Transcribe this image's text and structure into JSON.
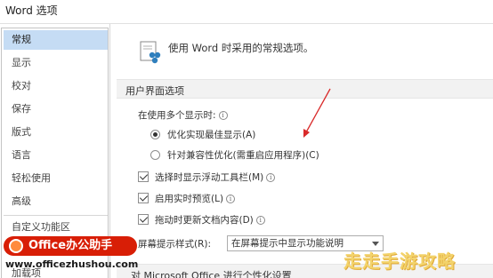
{
  "window": {
    "title": "Word 选项"
  },
  "sidebar": {
    "items": [
      {
        "label": "常规",
        "selected": true
      },
      {
        "label": "显示"
      },
      {
        "label": "校对"
      },
      {
        "label": "保存"
      },
      {
        "label": "版式"
      },
      {
        "label": "语言"
      },
      {
        "label": "轻松使用"
      },
      {
        "label": "高级"
      },
      {
        "label": "自定义功能区"
      },
      {
        "label": "加载项"
      }
    ]
  },
  "main": {
    "header": {
      "text": "使用 Word 时采用的常规选项。",
      "icon": "general-options-icon"
    },
    "section_ui": {
      "title": "用户界面选项",
      "multi_display_label": "在使用多个显示时:",
      "radios": [
        {
          "label": "优化实现最佳显示(A)",
          "checked": true
        },
        {
          "label": "针对兼容性优化(需重启应用程序)(C)",
          "checked": false
        }
      ],
      "checkboxes": [
        {
          "label": "选择时显示浮动工具栏(M)",
          "checked": true
        },
        {
          "label": "启用实时预览(L)",
          "checked": true
        },
        {
          "label": "拖动时更新文档内容(D)",
          "checked": true
        }
      ],
      "tooltip_style": {
        "label": "屏幕提示样式(R):",
        "value": "在屏幕提示中显示功能说明"
      }
    },
    "section_office": {
      "title": "对 Microsoft Office 进行个性化设置"
    }
  },
  "watermark": {
    "badge": "Office办公助手",
    "url": "www.officezhushou.com",
    "corner": "走走手游攻略"
  },
  "colors": {
    "selected_bg": "#c5dcf4",
    "annotation_arrow": "#d92a2a",
    "badge_red": "#d81e06"
  }
}
